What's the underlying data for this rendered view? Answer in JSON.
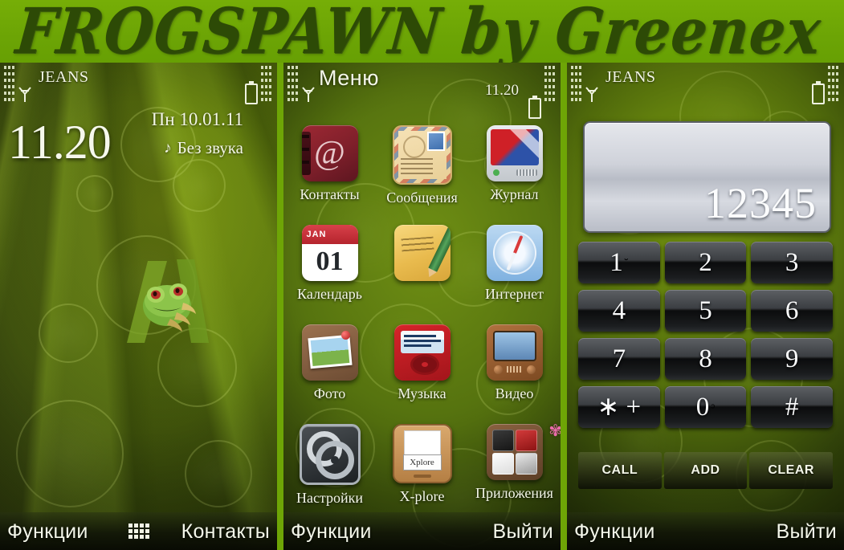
{
  "banner": {
    "title": "FROGSPAWN by Greenex",
    "bg_color": "#6ea506",
    "text_color": "#2d4a06"
  },
  "panel_home": {
    "operator": "JEANS",
    "clock": "11.20",
    "date": "Пн 10.01.11",
    "profile": "Без звука",
    "note_glyph": "♪",
    "softkey_left": "Функции",
    "softkey_right": "Контакты",
    "signal_icon": "signal-icon",
    "battery_icon": "battery-icon",
    "keypad_icon": "keypad-icon",
    "wallpaper": "green-tree-frog-on-leaf"
  },
  "panel_menu": {
    "title": "Меню",
    "clock": "11.20",
    "softkey_left": "Функции",
    "softkey_right": "Выйти",
    "items": [
      {
        "label": "Контакты",
        "icon": "contacts-icon"
      },
      {
        "label": "Сообщения",
        "icon": "messaging-envelope-icon"
      },
      {
        "label": "Журнал",
        "icon": "call-log-icon"
      },
      {
        "label": "Календарь",
        "icon": "calendar-icon"
      },
      {
        "label": "",
        "icon": "notes-pencil-icon"
      },
      {
        "label": "Интернет",
        "icon": "internet-compass-icon"
      },
      {
        "label": "Фото",
        "icon": "photos-icon"
      },
      {
        "label": "Музыка",
        "icon": "music-player-icon"
      },
      {
        "label": "Видео",
        "icon": "video-tv-icon"
      },
      {
        "label": "Настройки",
        "icon": "settings-gears-icon"
      },
      {
        "label": "X-plore",
        "icon": "xplore-filebox-icon"
      },
      {
        "label": "Приложения",
        "icon": "applications-icon"
      }
    ],
    "calendar_month": "JAN",
    "calendar_day": "01",
    "xplore_label": "Xplore"
  },
  "panel_dialer": {
    "operator": "JEANS",
    "number": "12345",
    "softkey_left": "Функции",
    "softkey_right": "Выйти",
    "keys": [
      {
        "main": "1",
        "sup": "˘"
      },
      {
        "main": "2",
        "sup": ""
      },
      {
        "main": "3",
        "sup": ""
      },
      {
        "main": "4",
        "sup": ""
      },
      {
        "main": "5",
        "sup": ""
      },
      {
        "main": "6",
        "sup": ""
      },
      {
        "main": "7",
        "sup": ""
      },
      {
        "main": "8",
        "sup": ""
      },
      {
        "main": "9",
        "sup": ""
      },
      {
        "main": "∗ +",
        "sup": ""
      },
      {
        "main": "0",
        "sup": "ᵓ"
      },
      {
        "main": "#",
        "sup": ""
      }
    ],
    "actions": [
      "CALL",
      "ADD",
      "CLEAR"
    ]
  }
}
